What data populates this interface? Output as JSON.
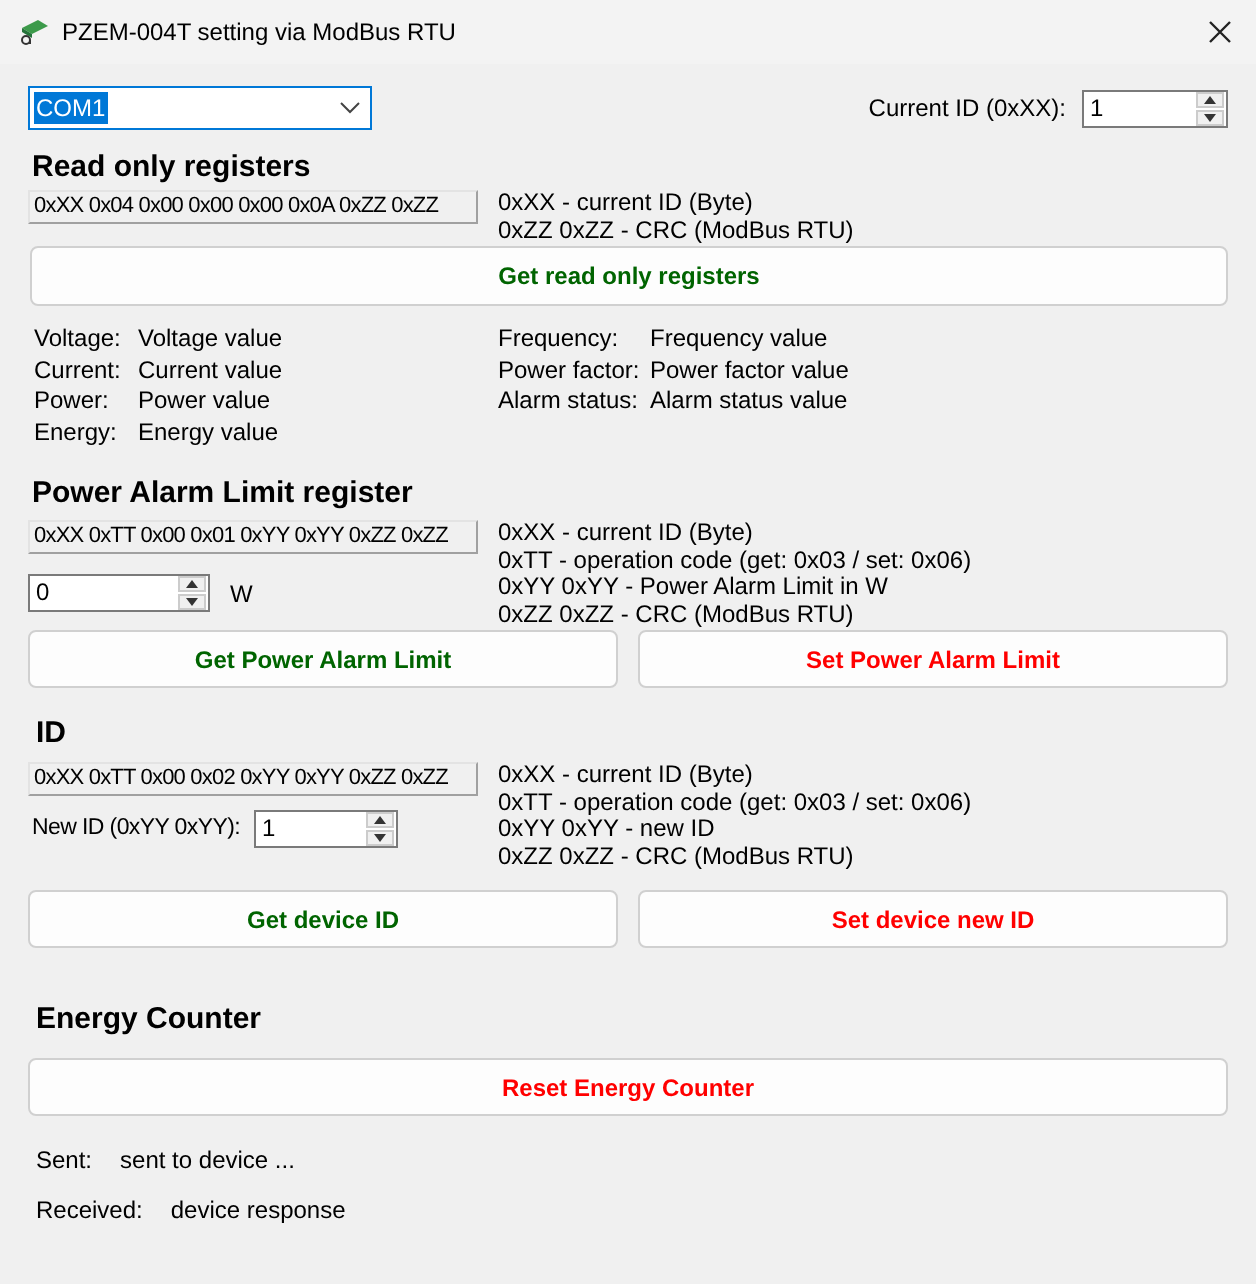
{
  "window": {
    "title": "PZEM-004T setting via ModBus RTU"
  },
  "port": {
    "value": "COM1",
    "highlighted": true
  },
  "current_id": {
    "label": "Current ID (0xXX):",
    "value": "1"
  },
  "read_only": {
    "heading": "Read only registers",
    "frame": "0xXX 0x04 0x00 0x00 0x00 0x0A 0xZZ 0xZZ",
    "notes": [
      "0xXX - current ID (Byte)",
      "0xZZ 0xZZ - CRC (ModBus RTU)"
    ],
    "buttons": [
      {
        "label": "Get read only registers",
        "kind": "get"
      }
    ],
    "readings_left": [
      {
        "label": "Voltage:",
        "value": "Voltage value"
      },
      {
        "label": "Current:",
        "value": "Current value"
      },
      {
        "label": "Power:",
        "value": "Power value"
      },
      {
        "label": "Energy:",
        "value": "Energy value"
      }
    ],
    "readings_right": [
      {
        "label": "Frequency:",
        "value": "Frequency value"
      },
      {
        "label": "Power factor:",
        "value": "Power factor value"
      },
      {
        "label": "Alarm status:",
        "value": "Alarm status value"
      }
    ]
  },
  "alarm": {
    "heading": "Power Alarm Limit register",
    "frame": "0xXX 0xTT 0x00 0x01 0xYY 0xYY 0xZZ 0xZZ",
    "value": "0",
    "unit": "W",
    "notes": [
      "0xXX - current ID (Byte)",
      "0xTT - operation code (get: 0x03 / set: 0x06)",
      "0xYY 0xYY - Power Alarm Limit in W",
      "0xZZ 0xZZ - CRC (ModBus RTU)"
    ],
    "buttons": [
      {
        "label": "Get Power Alarm Limit",
        "kind": "get"
      },
      {
        "label": "Set Power Alarm Limit",
        "kind": "set"
      }
    ]
  },
  "id": {
    "heading": "ID",
    "frame": "0xXX 0xTT 0x00 0x02 0xYY 0xYY 0xZZ 0xZZ",
    "label": "New ID (0xYY 0xYY):",
    "value": "1",
    "notes": [
      "0xXX - current ID (Byte)",
      "0xTT - operation code (get: 0x03 / set: 0x06)",
      "0xYY 0xYY - new ID",
      "0xZZ 0xZZ - CRC (ModBus RTU)"
    ],
    "buttons": [
      {
        "label": "Get device ID",
        "kind": "get"
      },
      {
        "label": "Set device new ID",
        "kind": "set"
      }
    ]
  },
  "energy": {
    "heading": "Energy Counter",
    "buttons": [
      {
        "label": "Reset Energy Counter",
        "kind": "set"
      }
    ]
  },
  "status": [
    {
      "label": "Sent:",
      "value": "sent to device ..."
    },
    {
      "label": "Received:",
      "value": "device response"
    }
  ]
}
